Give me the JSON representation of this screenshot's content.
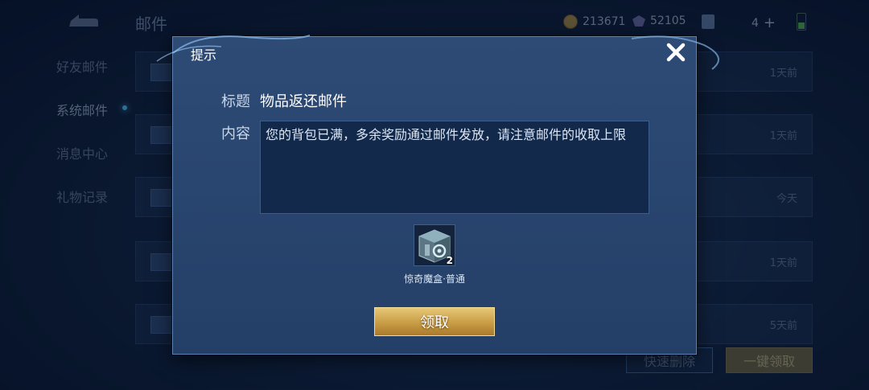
{
  "background": {
    "screen_title": "邮件",
    "currency": {
      "gold": "213671",
      "gems": "52105",
      "count": "4"
    },
    "sidebar": {
      "items": [
        {
          "label": "好友邮件"
        },
        {
          "label": "系统邮件"
        },
        {
          "label": "消息中心"
        },
        {
          "label": "礼物记录"
        }
      ]
    },
    "mail_list": {
      "rows": [
        {
          "time": "1天前"
        },
        {
          "time": "1天前"
        },
        {
          "time": "今天"
        },
        {
          "time": "1天前"
        },
        {
          "time": "5天前"
        }
      ]
    },
    "buttons": {
      "quick_delete": "快速删除",
      "claim_all": "一键领取"
    }
  },
  "dialog": {
    "title": "提示",
    "subject_label": "标题",
    "subject_value": "物品返还邮件",
    "content_label": "内容",
    "content_text": "您的背包已满，多余奖励通过邮件发放，请注意邮件的收取上限",
    "item": {
      "name": "惊奇魔盒·普通",
      "count": "2"
    },
    "claim_label": "领取"
  },
  "colors": {
    "accent_gold": "#c99c45",
    "dialog_bg": "#294670"
  }
}
